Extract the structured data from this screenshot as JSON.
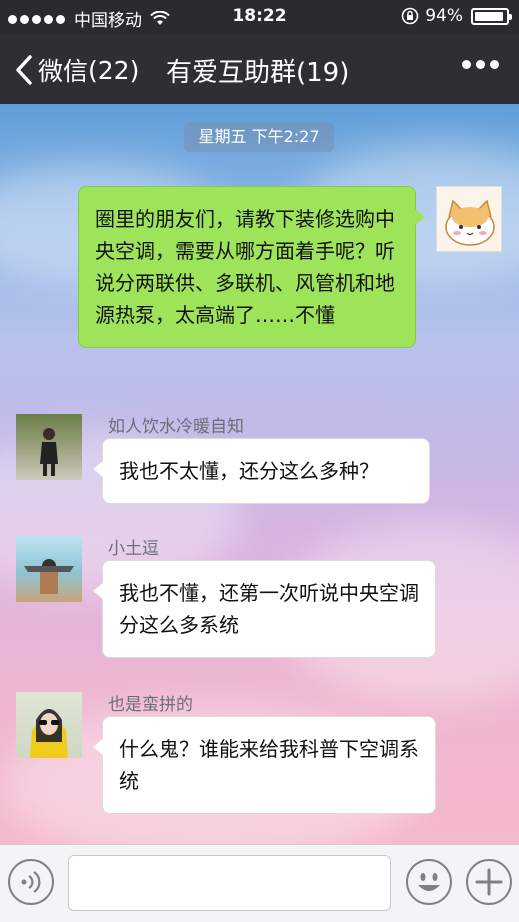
{
  "status_bar": {
    "carrier": "中国移动",
    "time": "18:22",
    "battery_percent": "94%",
    "battery_level": 0.94
  },
  "nav": {
    "back_label": "微信",
    "back_count": "(22)",
    "title": "有爱互助群(19)"
  },
  "chat": {
    "timestamp": "星期五 下午2:27",
    "messages": [
      {
        "sender": "",
        "text": "圈里的朋友们，请教下装修选购中央空调，需要从哪方面着手呢？听说分两联供、多联机、风管机和地源热泵，太高端了……不懂"
      },
      {
        "sender": "如人饮水冷暖自知",
        "text": "我也不太懂，还分这么多种？"
      },
      {
        "sender": "小土逗",
        "text": "我也不懂，还第一次听说中央空调分这么多系统"
      },
      {
        "sender": "也是蛮拼的",
        "text": "什么鬼？谁能来给我科普下空调系统"
      }
    ]
  },
  "input_bar": {
    "voice_icon": "voice-icon",
    "emoji_icon": "emoji-icon",
    "plus_icon": "plus-icon"
  }
}
